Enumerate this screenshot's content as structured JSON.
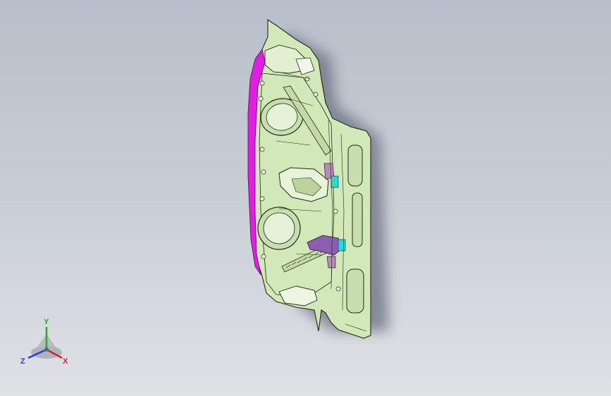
{
  "viewport": {
    "background_top": "#b8bfca",
    "background_bottom": "#dfe1e5"
  },
  "model": {
    "body_color": "#d3e8b8",
    "edge_color": "#1e2a12",
    "flange_color": "#e020e0",
    "highlight_color": "#2fd6d6",
    "bracket_color": "#8a5fb0",
    "shadow_color": "#6a7080"
  },
  "triad": {
    "x_label": "X",
    "y_label": "Y",
    "z_label": "Z",
    "x_color": "#e02020",
    "y_color": "#20b020",
    "z_color": "#2040e0"
  }
}
